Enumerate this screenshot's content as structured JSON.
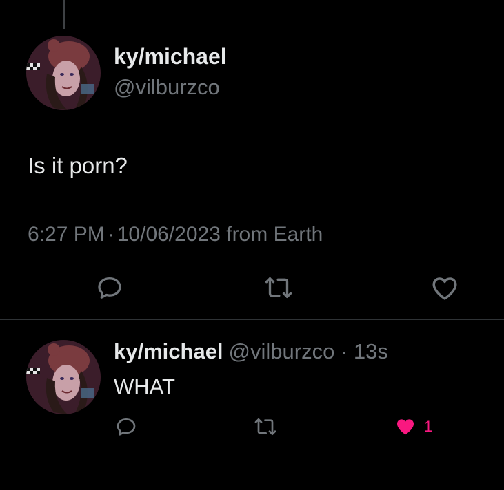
{
  "main_tweet": {
    "display_name": "ky/michael",
    "handle": "@vilburzco",
    "text": "Is it porn?",
    "time": "6:27 PM",
    "date": "10/06/2023",
    "source": "from Earth"
  },
  "reply": {
    "display_name": "ky/michael",
    "handle": "@vilburzco",
    "time_ago": "13s",
    "text": "WHAT",
    "like_count": "1"
  },
  "icons": {
    "reply": "reply-icon",
    "retweet": "retweet-icon",
    "like": "heart-icon",
    "liked": "heart-filled-icon"
  },
  "colors": {
    "background": "#000000",
    "text_primary": "#e7e9ea",
    "text_secondary": "#71767b",
    "divider": "#2f3336",
    "like_active": "#f91880"
  }
}
